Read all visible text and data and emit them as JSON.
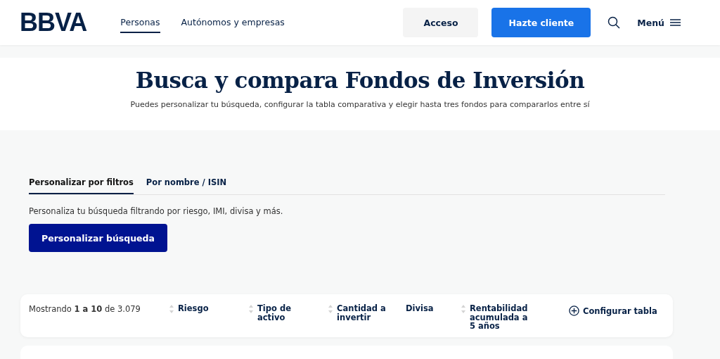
{
  "header": {
    "logo": "BBVA",
    "nav": [
      {
        "label": "Personas",
        "selected": true
      },
      {
        "label": "Autónomos y empresas",
        "selected": false
      }
    ],
    "access_button": "Acceso",
    "signup_button": "Hazte cliente",
    "menu": "Menú"
  },
  "hero": {
    "title": "Busca y compara Fondos de Inversión",
    "subtitle": "Puedes personalizar tu búsqueda, configurar la tabla comparativa y elegir hasta tres fondos para compararlos entre sí"
  },
  "tabs": [
    {
      "label": "Personalizar por filtros",
      "selected": true
    },
    {
      "label": "Por nombre / ISIN",
      "selected": false
    }
  ],
  "filter_text": "Personaliza tu búsqueda filtrando por riesgo, IMI, divisa y más.",
  "filter_button": "Personalizar búsqueda",
  "table": {
    "count": "Mostrando **1 a 10** de 3.079",
    "columns": [
      {
        "label": "Riesgo",
        "sortable": true
      },
      {
        "label": "Tipo de activo",
        "sortable": true
      },
      {
        "label": "Cantidad a invertir",
        "sortable": true
      },
      {
        "label": "Divisa",
        "sortable": false
      },
      {
        "label": "Rentabilidad acumulada a 5 años",
        "sortable": true
      }
    ],
    "configure": "Configurar tabla"
  }
}
